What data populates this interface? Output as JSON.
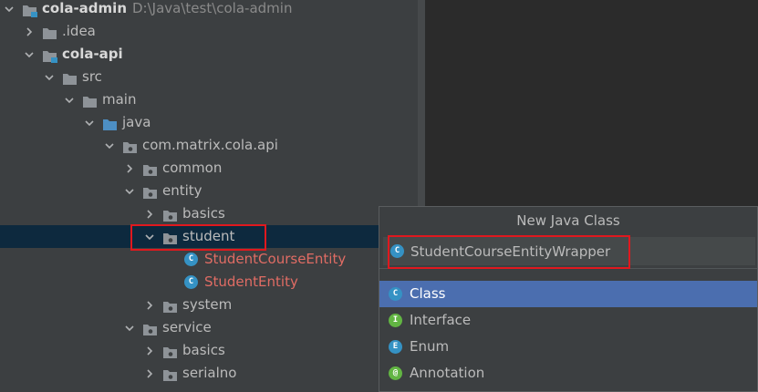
{
  "tree": {
    "rows": [
      {
        "label": "cola-admin",
        "path": "D:\\Java\\test\\cola-admin",
        "bold": true,
        "expanded": true,
        "icon": "module-folder-icon"
      },
      {
        "label": ".idea",
        "expanded": false,
        "icon": "folder-icon"
      },
      {
        "label": "cola-api",
        "bold": true,
        "expanded": true,
        "icon": "module-folder-icon"
      },
      {
        "label": "src",
        "expanded": true,
        "icon": "folder-icon"
      },
      {
        "label": "main",
        "expanded": true,
        "icon": "folder-icon"
      },
      {
        "label": "java",
        "expanded": true,
        "icon": "source-folder-icon"
      },
      {
        "label": "com.matrix.cola.api",
        "expanded": true,
        "icon": "package-icon"
      },
      {
        "label": "common",
        "expanded": false,
        "icon": "package-icon"
      },
      {
        "label": "entity",
        "expanded": true,
        "icon": "package-icon"
      },
      {
        "label": "basics",
        "expanded": false,
        "icon": "package-icon"
      },
      {
        "label": "student",
        "expanded": true,
        "icon": "package-icon",
        "selected": true
      },
      {
        "label": "StudentCourseEntity",
        "icon": "class-icon",
        "red": true
      },
      {
        "label": "StudentEntity",
        "icon": "class-icon",
        "red": true
      },
      {
        "label": "system",
        "expanded": false,
        "icon": "package-icon"
      },
      {
        "label": "service",
        "expanded": true,
        "icon": "package-icon"
      },
      {
        "label": "basics",
        "expanded": false,
        "icon": "package-icon"
      },
      {
        "label": "serialno",
        "expanded": false,
        "icon": "package-icon"
      },
      {
        "label": "",
        "expanded": false,
        "icon": "package-icon"
      }
    ]
  },
  "popup": {
    "title": "New Java Class",
    "input_value": "StudentCourseEntityWrapper",
    "input_badge": "C",
    "options": [
      {
        "label": "Class",
        "badge": "C",
        "color": "#3592c4",
        "selected": true
      },
      {
        "label": "Interface",
        "badge": "I",
        "color": "#62b543",
        "selected": false
      },
      {
        "label": "Enum",
        "badge": "E",
        "color": "#3592c4",
        "selected": false
      },
      {
        "label": "Annotation",
        "badge": "@",
        "color": "#62b543",
        "selected": false
      }
    ]
  },
  "colors": {
    "folder": "#8e9398",
    "module_badge": "#3592c4",
    "highlight": "#e0181e",
    "selection": "#0d293e"
  }
}
